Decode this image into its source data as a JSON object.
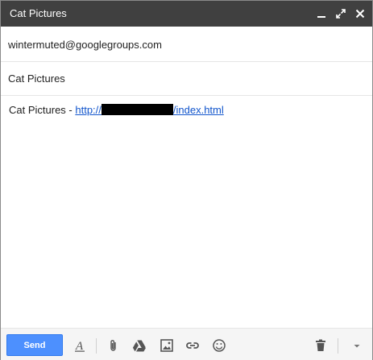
{
  "window": {
    "title": "Cat Pictures",
    "controls": [
      "minimize-icon",
      "expand-icon",
      "close-icon"
    ]
  },
  "to": {
    "value": "wintermuted@googlegroups.com"
  },
  "subject": {
    "value": "Cat Pictures"
  },
  "body": {
    "prefix": "Cat Pictures - ",
    "link_start": "http://",
    "link_end": "/index.html"
  },
  "toolbar": {
    "send_label": "Send",
    "send_color": "#4d90fe",
    "tools": [
      "formatting-icon",
      "attach-icon",
      "drive-icon",
      "photo-icon",
      "link-icon",
      "emoji-icon"
    ],
    "right_tools": [
      "trash-icon",
      "more-options-icon"
    ]
  },
  "colors": {
    "titlebar": "#404040",
    "link": "#1155cc"
  }
}
